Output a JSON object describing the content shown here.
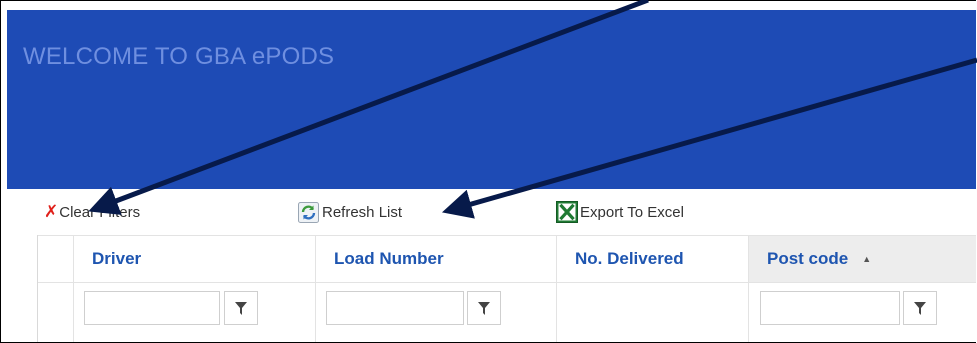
{
  "banner": {
    "title": "WELCOME TO GBA ePODS",
    "color": "#1e4bb5"
  },
  "toolbar": {
    "clear_filters": "Clear Filters",
    "refresh_list": "Refresh List",
    "export_excel": "Export To Excel"
  },
  "grid": {
    "columns": [
      {
        "label": "Driver",
        "sorted": false
      },
      {
        "label": "Load Number",
        "sorted": false
      },
      {
        "label": "No. Delivered",
        "sorted": false
      },
      {
        "label": "Post code",
        "sorted": true,
        "sort_dir": "ascending"
      }
    ],
    "filters": [
      {
        "column": "Driver",
        "value": ""
      },
      {
        "column": "Load Number",
        "value": ""
      },
      {
        "column": "Post code",
        "value": ""
      }
    ]
  },
  "icons": [
    "x-icon",
    "refresh-icon",
    "excel-icon",
    "filter-icon",
    "sort-ascending-icon"
  ],
  "accent": "#1e55b0"
}
